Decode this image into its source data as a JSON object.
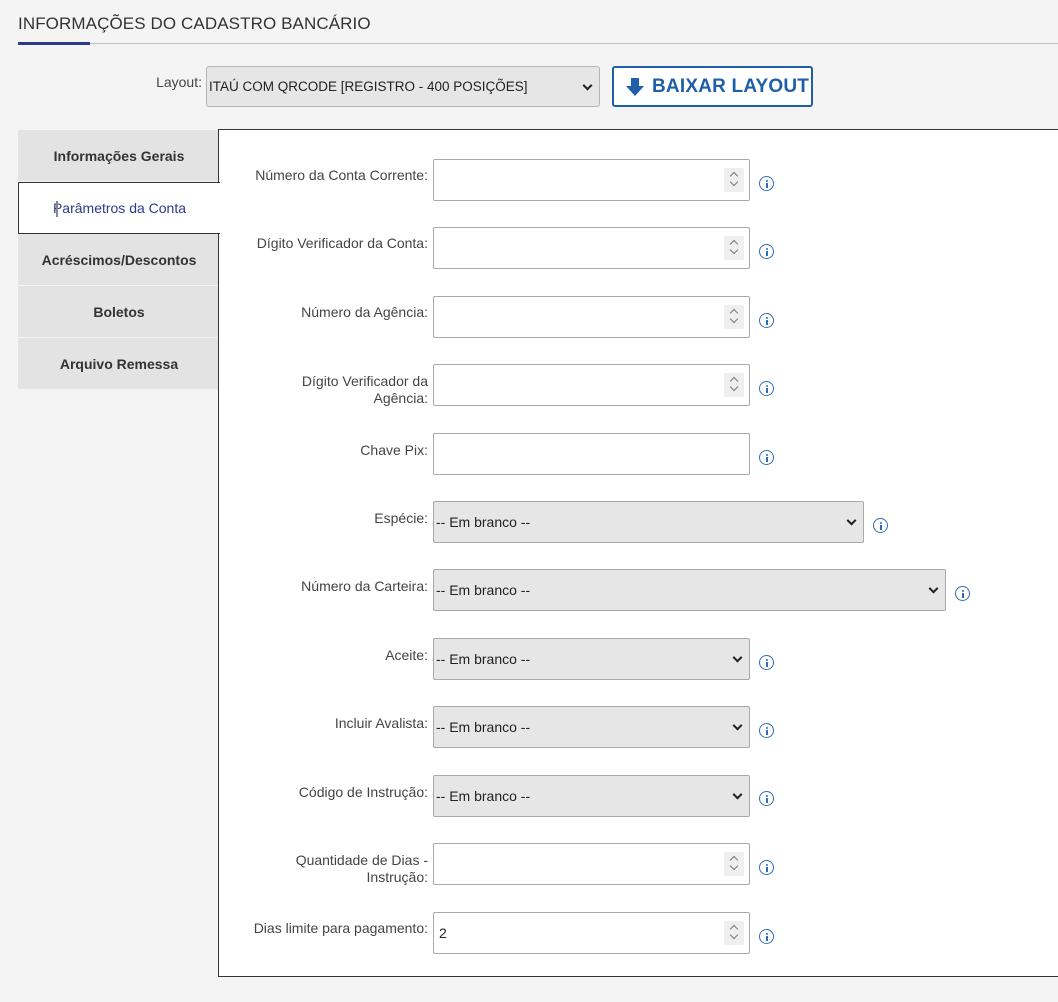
{
  "header": {
    "title": "INFORMAÇÕES DO CADASTRO BANCÁRIO"
  },
  "layout": {
    "label": "Layout:",
    "selected": "ITAÚ COM QRCODE [REGISTRO - 400 POSIÇÕES]",
    "download_label": "BAIXAR LAYOUT"
  },
  "tabs": [
    {
      "label": "Informações Gerais",
      "active": false
    },
    {
      "label": "Parâmetros da Conta",
      "active": true
    },
    {
      "label": "Acréscimos/Descontos",
      "active": false
    },
    {
      "label": "Boletos",
      "active": false
    },
    {
      "label": "Arquivo Remessa",
      "active": false
    }
  ],
  "fields": {
    "numero_conta": {
      "label": "Número da Conta Corrente:",
      "value": ""
    },
    "digito_conta": {
      "label": "Dígito Verificador da Conta:",
      "value": ""
    },
    "numero_agencia": {
      "label": "Número da Agência:",
      "value": ""
    },
    "digito_agencia": {
      "label_line1": "Dígito Verificador da",
      "label_line2": "Agência:",
      "value": ""
    },
    "chave_pix": {
      "label": "Chave Pix:",
      "value": ""
    },
    "especie": {
      "label": "Espécie:",
      "value": "-- Em branco --"
    },
    "numero_carteira": {
      "label": "Número da Carteira:",
      "value": "-- Em branco --"
    },
    "aceite": {
      "label": "Aceite:",
      "value": "-- Em branco --"
    },
    "incluir_avalista": {
      "label": "Incluir Avalista:",
      "value": "-- Em branco --"
    },
    "codigo_instrucao": {
      "label": "Código de Instrução:",
      "value": "-- Em branco --"
    },
    "qtd_dias_instrucao": {
      "label_line1": "Quantidade de Dias -",
      "label_line2": "Instrução:",
      "value": ""
    },
    "dias_limite": {
      "label": "Dias limite para pagamento:",
      "value": "2"
    }
  }
}
